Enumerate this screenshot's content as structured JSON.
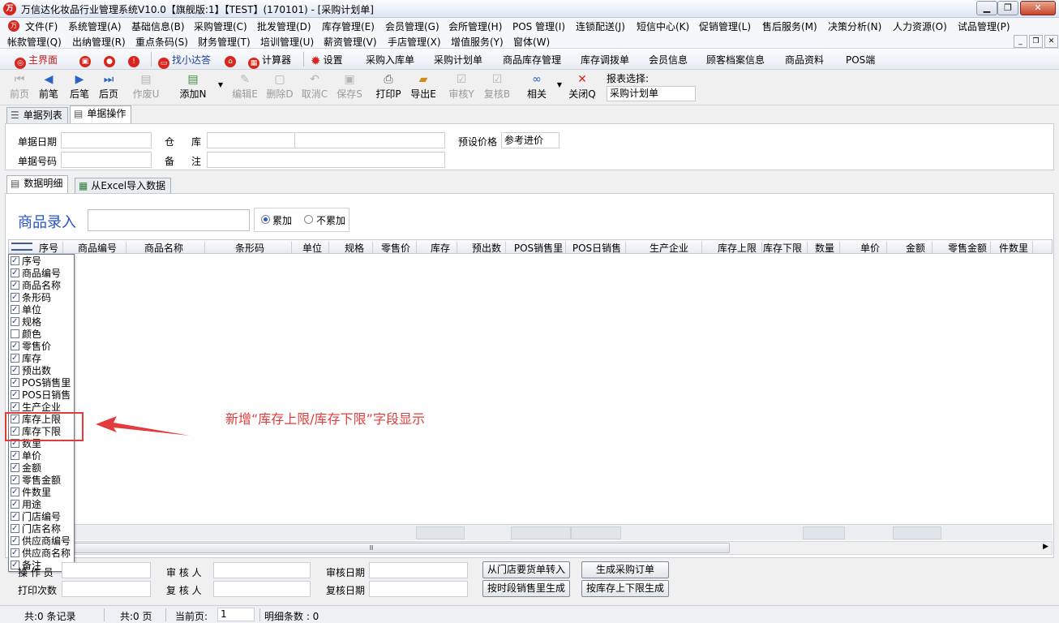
{
  "window": {
    "title": "万信达化妆品行业管理系统V10.0【旗舰版:1】【TEST】(170101) - [采购计划单]",
    "minimize": "▁",
    "restore": "❐",
    "close": "✕"
  },
  "menu": {
    "row1": [
      "文件(F)",
      "系统管理(A)",
      "基础信息(B)",
      "采购管理(C)",
      "批发管理(D)",
      "库存管理(E)",
      "会员管理(G)",
      "会所管理(H)",
      "POS 管理(I)",
      "连锁配送(J)",
      "短信中心(K)",
      "促销管理(L)",
      "售后服务(M)",
      "决策分析(N)",
      "人力资源(O)",
      "试品管理(P)"
    ],
    "row2": [
      "帐款管理(Q)",
      "出纳管理(R)",
      "重点条码(S)",
      "财务管理(T)",
      "培训管理(U)",
      "薪资管理(V)",
      "手店管理(X)",
      "增值服务(Y)",
      "窗体(W)"
    ],
    "mdi": [
      "_",
      "❐",
      "✕"
    ]
  },
  "quickbar": {
    "home": "主界面",
    "find": "找小达答",
    "calc": "计算器",
    "settings": "设置",
    "links": [
      "采购入库单",
      "采购计划单",
      "商品库存管理",
      "库存调拨单",
      "会员信息",
      "顾客档案信息",
      "商品资料",
      "POS端"
    ]
  },
  "toolbar": {
    "first": "前页",
    "prev": "前笔",
    "next": "后笔",
    "last": "后页",
    "void": "作废U",
    "add": "添加N",
    "edit": "编辑E",
    "delete": "删除D",
    "cancel": "取消C",
    "save": "保存S",
    "print": "打印P",
    "export": "导出E",
    "audit": "审核Y",
    "reaudit": "复核B",
    "related": "相关",
    "close": "关闭Q",
    "report_label": "报表选择:",
    "report_value": "采购计划单"
  },
  "tabs": {
    "list": "单据列表",
    "operate": "单据操作"
  },
  "form": {
    "date_label": "单据日期",
    "wh_label1": "仓",
    "wh_label2": "库",
    "price_label": "预设价格",
    "price_value": "参考进价",
    "no_label": "单据号码",
    "note_label1": "备",
    "note_label2": "注"
  },
  "subtabs": {
    "detail": "数据明细",
    "excel": "从Excel导入数据"
  },
  "entry": {
    "label": "商品录入",
    "opt_add": "累加",
    "opt_noadd": "不累加"
  },
  "grid": {
    "headers": [
      "序号",
      "商品编号",
      "商品名称",
      "条形码",
      "单位",
      "规格",
      "零售价",
      "库存",
      "预出数",
      "POS销售里",
      "POS日销售",
      "生产企业",
      "库存上限",
      "库存下限",
      "数量",
      "单价",
      "金额",
      "零售金额",
      "件数里"
    ],
    "scroll_thumb": "Ⅲ"
  },
  "columns": [
    {
      "label": "序号",
      "on": true
    },
    {
      "label": "商品编号",
      "on": true
    },
    {
      "label": "商品名称",
      "on": true
    },
    {
      "label": "条形码",
      "on": true
    },
    {
      "label": "单位",
      "on": true
    },
    {
      "label": "规格",
      "on": true
    },
    {
      "label": "颜色",
      "on": false
    },
    {
      "label": "零售价",
      "on": true
    },
    {
      "label": "库存",
      "on": true
    },
    {
      "label": "预出数",
      "on": true
    },
    {
      "label": "POS销售里",
      "on": true
    },
    {
      "label": "POS日销售",
      "on": true
    },
    {
      "label": "生产企业",
      "on": true
    },
    {
      "label": "库存上限",
      "on": true
    },
    {
      "label": "库存下限",
      "on": true
    },
    {
      "label": "数里",
      "on": true
    },
    {
      "label": "单价",
      "on": true
    },
    {
      "label": "金额",
      "on": true
    },
    {
      "label": "零售金额",
      "on": true
    },
    {
      "label": "件数里",
      "on": true
    },
    {
      "label": "用途",
      "on": true
    },
    {
      "label": "门店编号",
      "on": true
    },
    {
      "label": "门店名称",
      "on": true
    },
    {
      "label": "供应商编号",
      "on": true
    },
    {
      "label": "供应商名称",
      "on": true
    },
    {
      "label": "备注",
      "on": true
    }
  ],
  "annotation": "新增“库存上限/库存下限”字段显示",
  "bottom": {
    "operator_label": "操 作 员",
    "auditor_label": "审 核 人",
    "audit_date_label": "审核日期",
    "print_count_label": "打印次数",
    "reviewer_label": "复 核 人",
    "review_date_label": "复核日期",
    "btn_from_store": "从门店要货单转入",
    "btn_gen_po": "生成采购订单",
    "btn_by_sales": "按时段销售里生成",
    "btn_by_limits": "按库存上下限生成"
  },
  "status": {
    "records": "共:0 条记录",
    "pages": "共:0 页",
    "current_label": "当前页:",
    "current_value": "1",
    "detail_count": "明细条数 : 0"
  }
}
